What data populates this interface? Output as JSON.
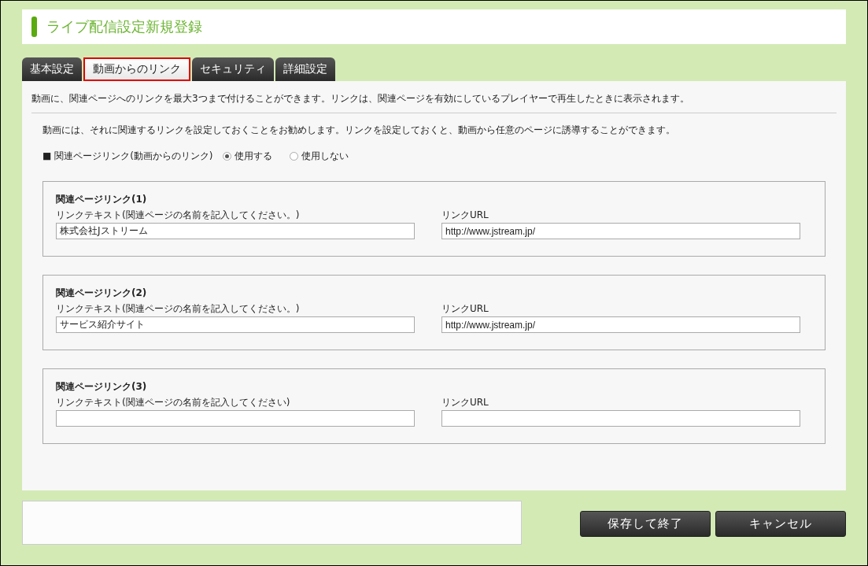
{
  "title": "ライブ配信設定新規登録",
  "tabs": [
    {
      "label": "基本設定",
      "selected": false
    },
    {
      "label": "動画からのリンク",
      "selected": true
    },
    {
      "label": "セキュリティ",
      "selected": false
    },
    {
      "label": "詳細設定",
      "selected": false
    }
  ],
  "intro": "動画に、関連ページへのリンクを最大3つまで付けることができます。リンクは、関連ページを有効にしているプレイヤーで再生したときに表示されます。",
  "note": "動画には、それに関連するリンクを設定しておくことをお勧めします。リンクを設定しておくと、動画から任意のページに誘導することができます。",
  "link_setting": {
    "label": "■ 関連ページリンク(動画からのリンク)",
    "options": [
      {
        "label": "使用する",
        "selected": true
      },
      {
        "label": "使用しない",
        "selected": false
      }
    ]
  },
  "links": [
    {
      "heading": "関連ページリンク(1)",
      "text_label": "リンクテキスト(関連ページの名前を記入してください。)",
      "text_value": "株式会社Jストリーム",
      "url_label": "リンクURL",
      "url_value": "http://www.jstream.jp/"
    },
    {
      "heading": "関連ページリンク(2)",
      "text_label": "リンクテキスト(関連ページの名前を記入してください。)",
      "text_value": "サービス紹介サイト",
      "url_label": "リンクURL",
      "url_value": "http://www.jstream.jp/"
    },
    {
      "heading": "関連ページリンク(3)",
      "text_label": "リンクテキスト(関連ページの名前を記入してください)",
      "url_label": "リンクURL"
    }
  ],
  "buttons": [
    "保存して終了",
    "キャンセル"
  ]
}
